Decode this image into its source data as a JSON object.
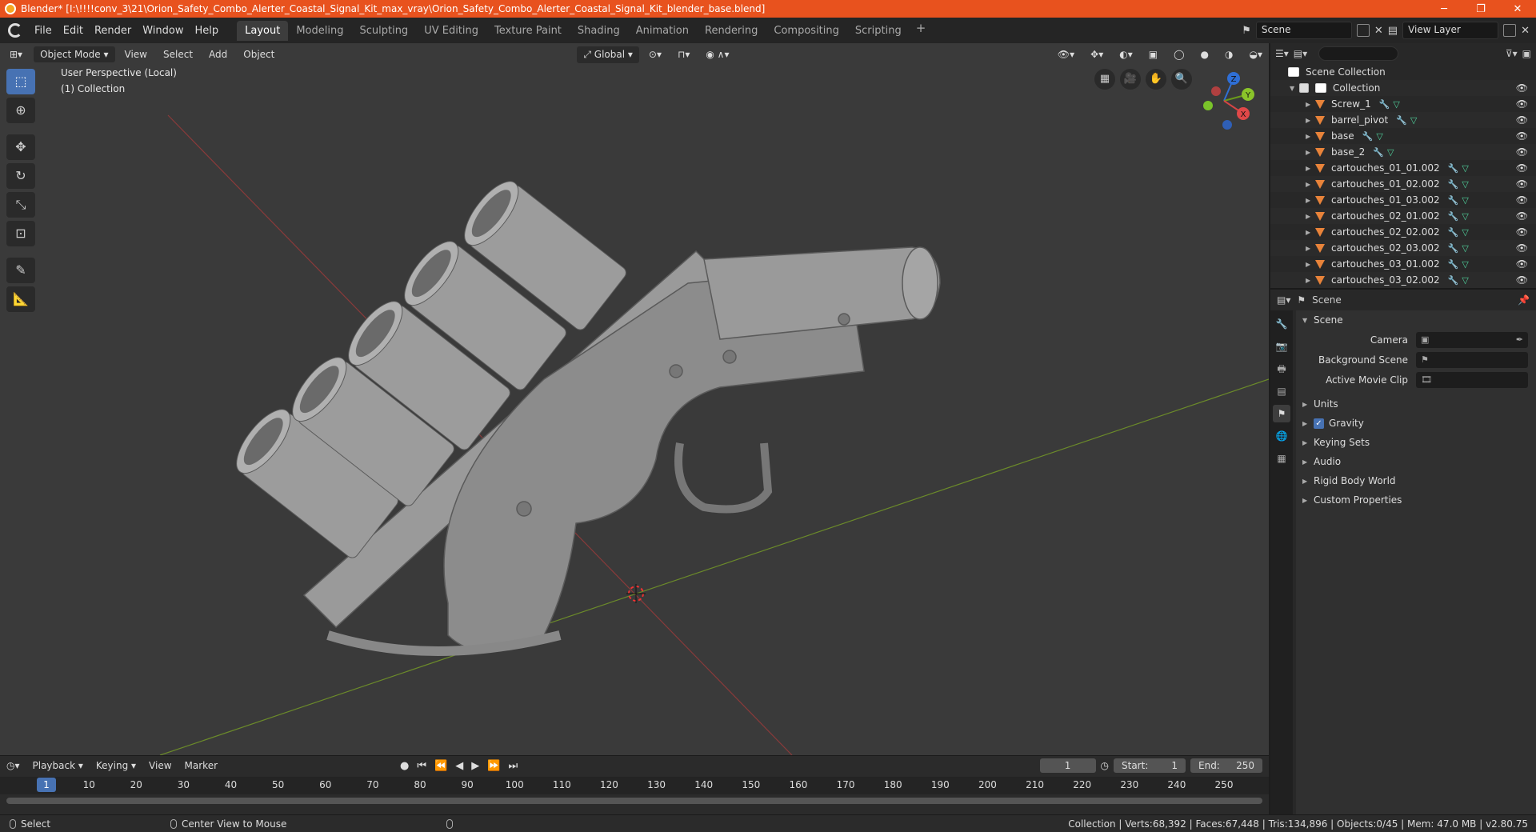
{
  "window": {
    "title": "Blender* [I:\\!!!!conv_3\\21\\Orion_Safety_Combo_Alerter_Coastal_Signal_Kit_max_vray\\Orion_Safety_Combo_Alerter_Coastal_Signal_Kit_blender_base.blend]",
    "minimize": "─",
    "maximize": "❐",
    "close": "✕"
  },
  "menu": {
    "items": [
      "File",
      "Edit",
      "Render",
      "Window",
      "Help"
    ],
    "workspaces": [
      "Layout",
      "Modeling",
      "Sculpting",
      "UV Editing",
      "Texture Paint",
      "Shading",
      "Animation",
      "Rendering",
      "Compositing",
      "Scripting"
    ],
    "active_workspace": "Layout",
    "add_workspace": "+",
    "scene": "Scene",
    "view_layer": "View Layer"
  },
  "viewport": {
    "mode": "Object Mode",
    "menus": [
      "View",
      "Select",
      "Add",
      "Object"
    ],
    "transform_orientation": "Global",
    "perspective_label": "User Perspective (Local)",
    "collection_label": "(1) Collection",
    "gizmo": {
      "z": "Z",
      "y": "Y",
      "x": "X"
    }
  },
  "outliner": {
    "root": "Scene Collection",
    "collection": "Collection",
    "objects": [
      "Screw_1",
      "barrel_pivot",
      "base",
      "base_2",
      "cartouches_01_01.002",
      "cartouches_01_02.002",
      "cartouches_01_03.002",
      "cartouches_02_01.002",
      "cartouches_02_02.002",
      "cartouches_02_03.002",
      "cartouches_03_01.002",
      "cartouches_03_02.002"
    ]
  },
  "properties": {
    "context": "Scene",
    "panel": "Scene",
    "fields": [
      {
        "label": "Camera",
        "value": ""
      },
      {
        "label": "Background Scene",
        "value": ""
      },
      {
        "label": "Active Movie Clip",
        "value": ""
      }
    ],
    "subpanels": [
      "Units",
      "Gravity",
      "Keying Sets",
      "Audio",
      "Rigid Body World",
      "Custom Properties"
    ],
    "gravity_checked": true
  },
  "timeline": {
    "menus": [
      "Playback",
      "Keying",
      "View",
      "Marker"
    ],
    "current_frame": "1",
    "start_label": "Start:",
    "start": "1",
    "end_label": "End:",
    "end": "250",
    "ruler": [
      "1",
      "10",
      "20",
      "30",
      "40",
      "50",
      "60",
      "70",
      "80",
      "90",
      "100",
      "110",
      "120",
      "130",
      "140",
      "150",
      "160",
      "170",
      "180",
      "190",
      "200",
      "210",
      "220",
      "230",
      "240",
      "250"
    ]
  },
  "statusbar": {
    "left": "Select",
    "middle": "Center View to Mouse",
    "stats": "Collection | Verts:68,392 | Faces:67,448 | Tris:134,896 | Objects:0/45 | Mem: 47.0 MB | v2.80.75"
  }
}
